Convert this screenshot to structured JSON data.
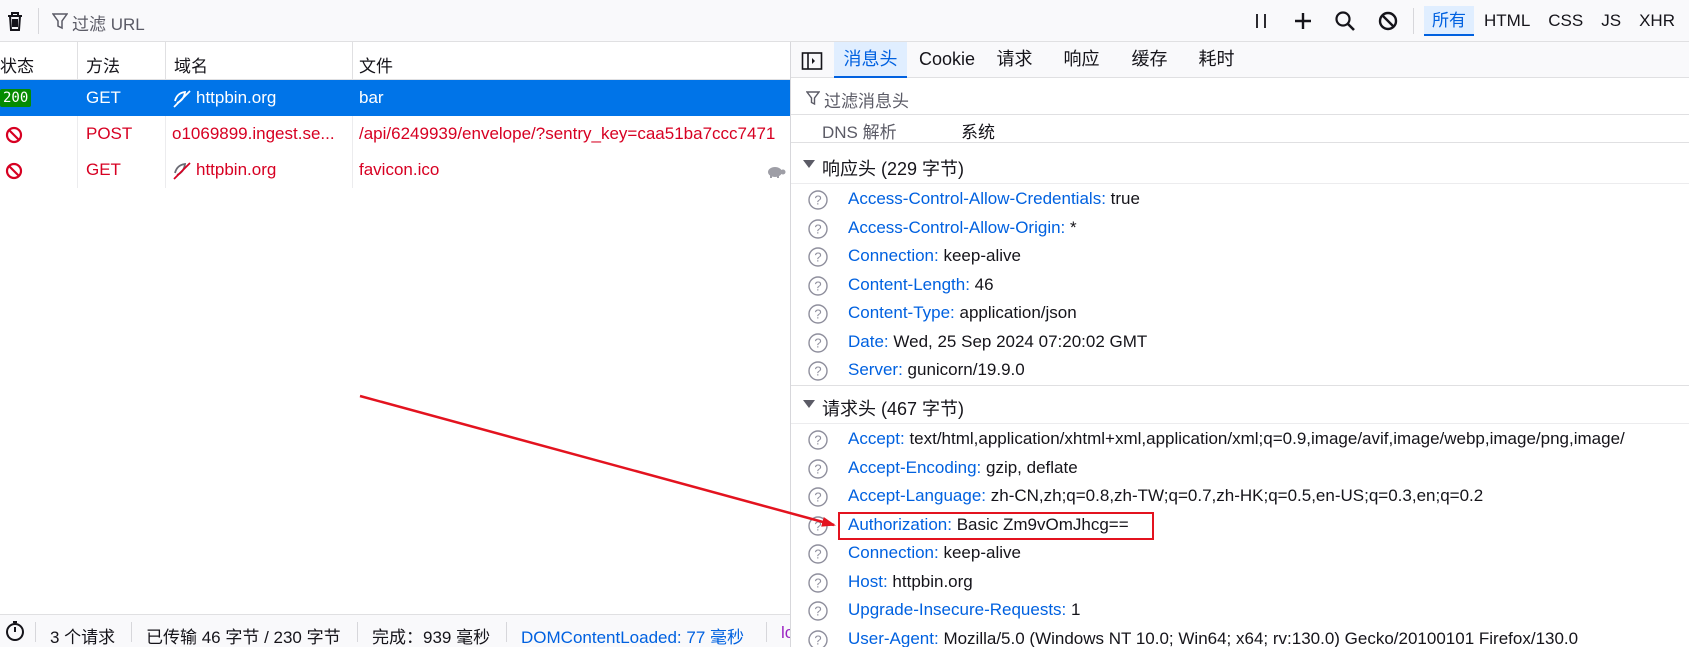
{
  "toolbar": {
    "filter_placeholder": "过滤 URL",
    "type_filters": [
      "所有",
      "HTML",
      "CSS",
      "JS",
      "XHR"
    ],
    "active_filter": "所有"
  },
  "columns": [
    "状态",
    "方法",
    "域名",
    "文件"
  ],
  "requests": [
    {
      "status": "200",
      "method": "GET",
      "domain": "httpbin.org",
      "file": "bar",
      "selected": true,
      "blocked": false
    },
    {
      "status": "",
      "method": "POST",
      "domain": "o1069899.ingest.se...",
      "file": "/api/6249939/envelope/?sentry_key=caa51ba7ccc7471",
      "selected": false,
      "blocked": true
    },
    {
      "status": "",
      "method": "GET",
      "domain": "httpbin.org",
      "file": "favicon.ico",
      "selected": false,
      "blocked": true
    }
  ],
  "statusbar": {
    "requests": "3 个请求",
    "transferred": "已传输 46 字节 / 230 字节",
    "finish": "完成：939 毫秒",
    "dcl": "DOMContentLoaded: 77 毫秒",
    "load_partial": "lo"
  },
  "tabs": [
    "消息头",
    "Cookie",
    "请求",
    "响应",
    "缓存",
    "耗时"
  ],
  "active_tab": "消息头",
  "filter_headers_placeholder": "过滤消息头",
  "dns": {
    "label": "DNS 解析",
    "value": "系统"
  },
  "response_section": {
    "title": "响应头 (229 字节)",
    "headers": [
      {
        "name": "Access-Control-Allow-Credentials:",
        "value": "true"
      },
      {
        "name": "Access-Control-Allow-Origin:",
        "value": "*"
      },
      {
        "name": "Connection:",
        "value": "keep-alive"
      },
      {
        "name": "Content-Length:",
        "value": "46"
      },
      {
        "name": "Content-Type:",
        "value": "application/json"
      },
      {
        "name": "Date:",
        "value": "Wed, 25 Sep 2024 07:20:02 GMT"
      },
      {
        "name": "Server:",
        "value": "gunicorn/19.9.0"
      }
    ]
  },
  "request_section": {
    "title": "请求头 (467 字节)",
    "headers": [
      {
        "name": "Accept:",
        "value": "text/html,application/xhtml+xml,application/xml;q=0.9,image/avif,image/webp,image/png,image/"
      },
      {
        "name": "Accept-Encoding:",
        "value": "gzip, deflate"
      },
      {
        "name": "Accept-Language:",
        "value": "zh-CN,zh;q=0.8,zh-TW;q=0.7,zh-HK;q=0.5,en-US;q=0.3,en;q=0.2"
      },
      {
        "name": "Authorization:",
        "value": "Basic Zm9vOmJhcg=="
      },
      {
        "name": "Connection:",
        "value": "keep-alive"
      },
      {
        "name": "Host:",
        "value": "httpbin.org"
      },
      {
        "name": "Upgrade-Insecure-Requests:",
        "value": "1"
      },
      {
        "name": "User-Agent:",
        "value": "Mozilla/5.0 (Windows NT 10.0; Win64; x64; rv:130.0) Gecko/20100101 Firefox/130.0"
      }
    ]
  },
  "colors": {
    "accent": "#0061e0",
    "selected_row": "#0074e8",
    "error": "#d70022",
    "annotation": "#e3131f",
    "status_ok": "#058b00"
  },
  "icons": [
    "trash-icon",
    "filter-icon",
    "pause-icon",
    "plus-icon",
    "search-icon",
    "block-icon",
    "sidebar-toggle-icon",
    "question-icon",
    "timer-icon",
    "turtle-icon",
    "tracker-blocked-icon"
  ]
}
